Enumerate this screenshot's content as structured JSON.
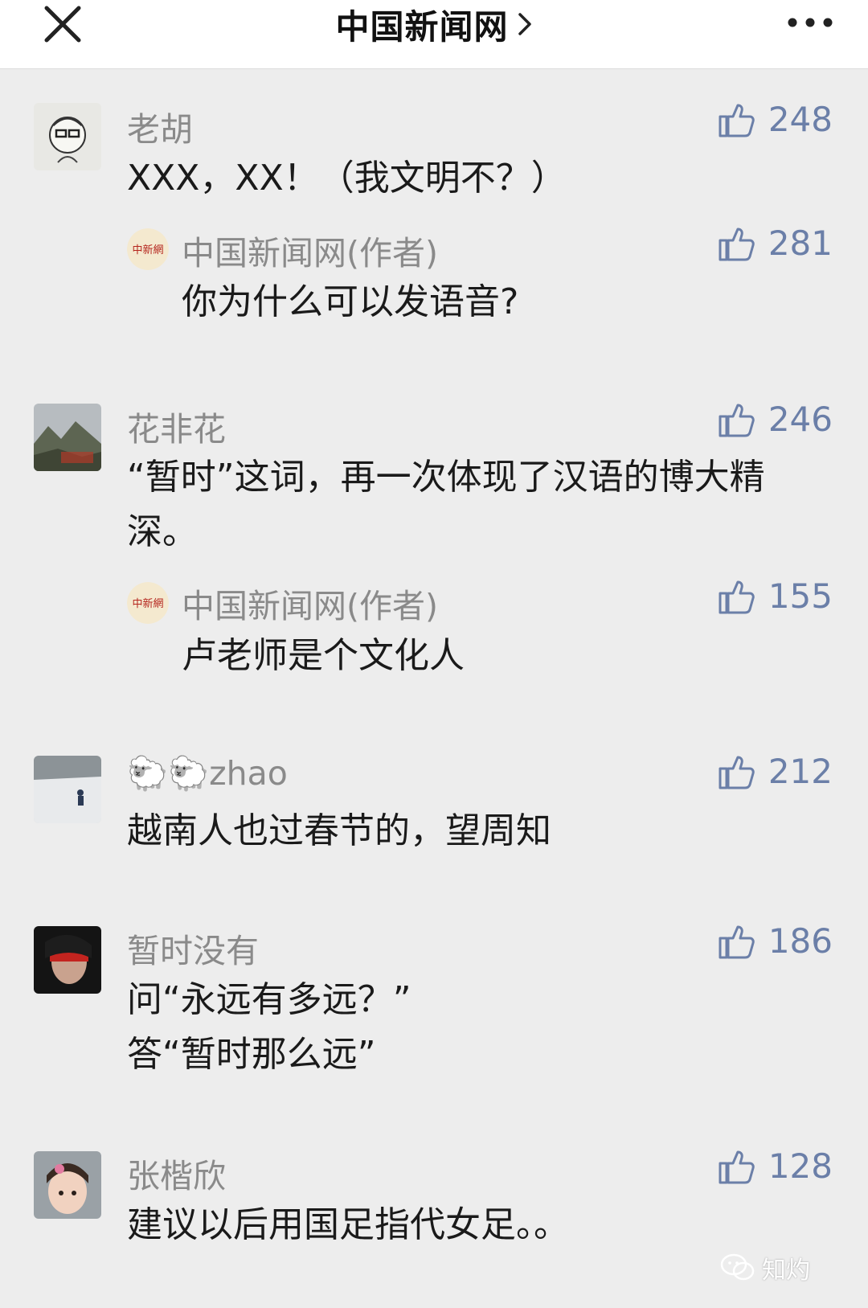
{
  "header": {
    "title": "中国新闻网",
    "close_icon": "close-icon",
    "chevron_icon": "chevron-right-icon",
    "more_icon": "more-dots-icon"
  },
  "comments": [
    {
      "name": "老胡",
      "likes": "248",
      "text": "XXX，XX！（我文明不？）",
      "reply": {
        "name": "中国新闻网(作者)",
        "likes": "281",
        "text": "你为什么可以发语音?"
      }
    },
    {
      "name": "花非花",
      "likes": "246",
      "text": "“暂时”这词，再一次体现了汉语的博大精深。",
      "reply": {
        "name": "中国新闻网(作者)",
        "likes": "155",
        "text": "卢老师是个文化人"
      }
    },
    {
      "name": "🐑🐑zhao",
      "likes": "212",
      "text": "越南人也过春节的，望周知"
    },
    {
      "name": "暂时没有",
      "likes": "186",
      "text_lines": [
        "问“永远有多远？”",
        "答“暂时那么远”"
      ]
    },
    {
      "name": "张楷欣",
      "likes": "128",
      "text": "建议以后用国足指代女足。。"
    }
  ],
  "watermark": {
    "text": "知灼",
    "icon": "wechat-icon"
  },
  "colors": {
    "like": "#6b7fa8",
    "name": "#8a8a8a",
    "background": "#ededed"
  }
}
